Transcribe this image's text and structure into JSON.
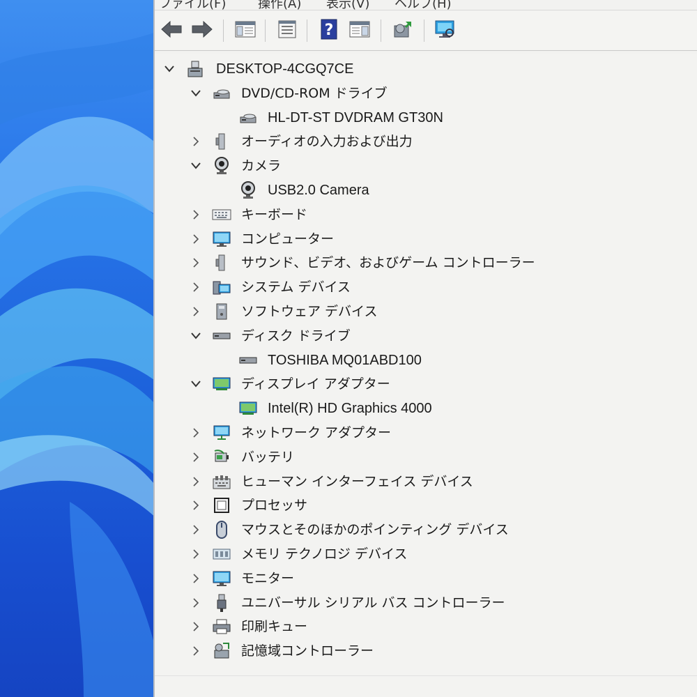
{
  "menu": [
    "ファイル(F)",
    "操作(A)",
    "表示(V)",
    "ヘルプ(H)"
  ],
  "toolbar": {
    "buttons": [
      {
        "name": "back-button",
        "icon": "arrow-left-icon"
      },
      {
        "name": "forward-button",
        "icon": "arrow-right-icon"
      },
      {
        "name": "show-hide-console-tree-button",
        "icon": "console-tree-icon"
      },
      {
        "name": "properties-button",
        "icon": "properties-icon"
      },
      {
        "name": "help-button",
        "icon": "help-icon"
      },
      {
        "name": "action-pane-button",
        "icon": "action-pane-icon"
      },
      {
        "name": "update-driver-button",
        "icon": "update-driver-icon"
      },
      {
        "name": "scan-hardware-button",
        "icon": "scan-hardware-icon"
      }
    ]
  },
  "tree": {
    "root": "DESKTOP-4CGQ7CE",
    "items": [
      {
        "label": "DVD/CD-ROM ドライブ",
        "level": 1,
        "expanded": true,
        "icon": "optical-drive-icon"
      },
      {
        "label": "HL-DT-ST DVDRAM GT30N",
        "level": 2,
        "icon": "optical-drive-icon"
      },
      {
        "label": "オーディオの入力および出力",
        "level": 1,
        "expanded": false,
        "icon": "speaker-icon"
      },
      {
        "label": "カメラ",
        "level": 1,
        "expanded": true,
        "icon": "camera-icon"
      },
      {
        "label": "USB2.0 Camera",
        "level": 2,
        "icon": "camera-icon"
      },
      {
        "label": "キーボード",
        "level": 1,
        "expanded": false,
        "icon": "keyboard-icon"
      },
      {
        "label": "コンピューター",
        "level": 1,
        "expanded": false,
        "icon": "computer-icon"
      },
      {
        "label": "サウンド、ビデオ、およびゲーム コントローラー",
        "level": 1,
        "expanded": false,
        "icon": "speaker-icon"
      },
      {
        "label": "システム デバイス",
        "level": 1,
        "expanded": false,
        "icon": "system-device-icon"
      },
      {
        "label": "ソフトウェア デバイス",
        "level": 1,
        "expanded": false,
        "icon": "software-device-icon"
      },
      {
        "label": "ディスク ドライブ",
        "level": 1,
        "expanded": true,
        "icon": "disk-drive-icon"
      },
      {
        "label": "TOSHIBA MQ01ABD100",
        "level": 2,
        "icon": "disk-drive-icon"
      },
      {
        "label": "ディスプレイ アダプター",
        "level": 1,
        "expanded": true,
        "icon": "display-adapter-icon"
      },
      {
        "label": "Intel(R) HD Graphics 4000",
        "level": 2,
        "icon": "display-adapter-icon"
      },
      {
        "label": "ネットワーク アダプター",
        "level": 1,
        "expanded": false,
        "icon": "network-adapter-icon"
      },
      {
        "label": "バッテリ",
        "level": 1,
        "expanded": false,
        "icon": "battery-icon"
      },
      {
        "label": "ヒューマン インターフェイス デバイス",
        "level": 1,
        "expanded": false,
        "icon": "hid-icon"
      },
      {
        "label": "プロセッサ",
        "level": 1,
        "expanded": false,
        "icon": "processor-icon"
      },
      {
        "label": "マウスとそのほかのポインティング デバイス",
        "level": 1,
        "expanded": false,
        "icon": "mouse-icon"
      },
      {
        "label": "メモリ テクノロジ デバイス",
        "level": 1,
        "expanded": false,
        "icon": "memory-icon"
      },
      {
        "label": "モニター",
        "level": 1,
        "expanded": false,
        "icon": "monitor-icon"
      },
      {
        "label": "ユニバーサル シリアル バス コントローラー",
        "level": 1,
        "expanded": false,
        "icon": "usb-icon"
      },
      {
        "label": "印刷キュー",
        "level": 1,
        "expanded": false,
        "icon": "printer-icon"
      },
      {
        "label": "記憶域コントローラー",
        "level": 1,
        "expanded": false,
        "icon": "storage-controller-icon"
      }
    ]
  }
}
